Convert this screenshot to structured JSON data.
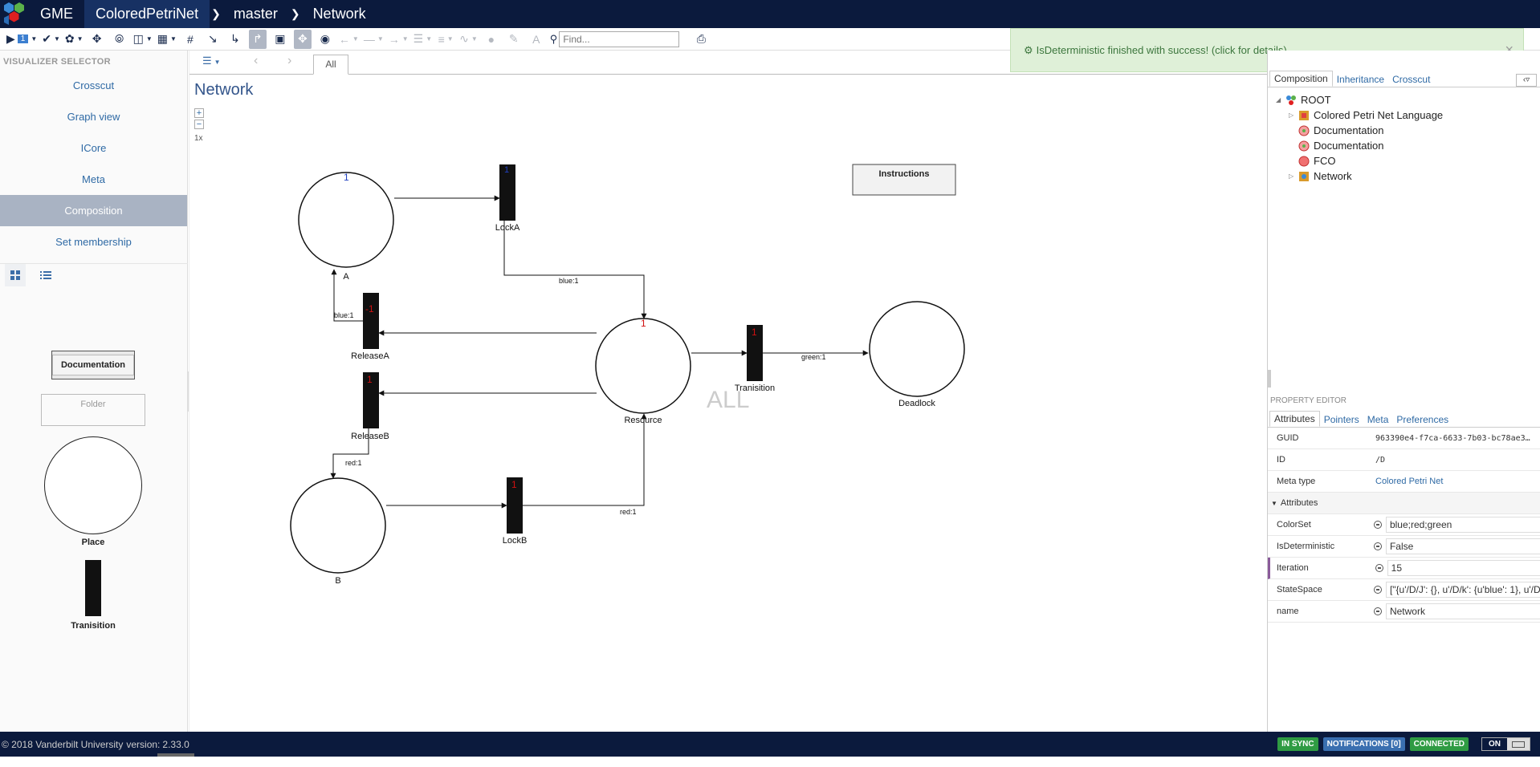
{
  "breadcrumb": {
    "app": "GME",
    "project": "ColoredPetriNet",
    "branch": "master",
    "node": "Network"
  },
  "toolbar": {
    "play_badge": "1",
    "find_placeholder": "Find..."
  },
  "visualizer_selector": {
    "title": "VISUALIZER SELECTOR",
    "items": [
      {
        "label": "Crosscut"
      },
      {
        "label": "Graph view"
      },
      {
        "label": "ICore"
      },
      {
        "label": "Meta"
      },
      {
        "label": "Composition",
        "selected": true
      },
      {
        "label": "Set membership"
      }
    ]
  },
  "part_browser": {
    "documentation": "Documentation",
    "folder": "Folder",
    "place": "Place",
    "transition": "Tranisition"
  },
  "editor": {
    "tab_all": "All",
    "title": "Network",
    "zoom_label": "1x",
    "instructions_box": "Instructions",
    "watermark": "ALL",
    "places": {
      "a": "A",
      "b": "B",
      "resource": "Resource",
      "deadlock": "Deadlock"
    },
    "transitions": {
      "locka": "LockA",
      "lockb": "LockB",
      "releasea": "ReleaseA",
      "releaseb": "ReleaseB",
      "tranisition": "Tranisition"
    },
    "arc_labels": {
      "blue1_locka": "blue:1",
      "blue1_releasea": "blue:1",
      "red1_releaseb": "red:1",
      "red1_lockb": "red:1",
      "green1": "green:1"
    },
    "tokens": {
      "a_blue": "1",
      "locka_blue": "1",
      "resource_red": "1",
      "releasea_marks": "-1",
      "releaseb_red": "1",
      "lockb_red": "1",
      "tranisition_red": "1"
    }
  },
  "notification": {
    "message": "IsDeterministic finished with success! (click for details)",
    "close": "×"
  },
  "object_browser": {
    "tabs": [
      "Composition",
      "Inheritance",
      "Crosscut"
    ],
    "tree": [
      {
        "label": "ROOT"
      },
      {
        "label": "Colored Petri Net Language"
      },
      {
        "label": "Documentation"
      },
      {
        "label": "Documentation"
      },
      {
        "label": "FCO"
      },
      {
        "label": "Network"
      }
    ]
  },
  "property_editor": {
    "title": "PROPERTY EDITOR",
    "tabs": [
      "Attributes",
      "Pointers",
      "Meta",
      "Preferences"
    ],
    "guid_label": "GUID",
    "guid_value": "963390e4-f7ca-6633-7b03-bc78ae3…",
    "id_label": "ID",
    "id_value": "/D",
    "metatype_label": "Meta type",
    "metatype_value": "Colored Petri Net",
    "attributes_section": "Attributes",
    "attributes": [
      {
        "name": "ColorSet",
        "value": "blue;red;green"
      },
      {
        "name": "IsDeterministic",
        "value": "False"
      },
      {
        "name": "Iteration",
        "value": "15"
      },
      {
        "name": "StateSpace",
        "value": "[\"{u'/D/J': {}, u'/D/k': {u'blue': 1}, u'/D/"
      },
      {
        "name": "name",
        "value": "Network"
      }
    ]
  },
  "footer": {
    "copyright": "© 2018 Vanderbilt University",
    "version_label": "version:",
    "version": "2.33.0",
    "in_sync": "IN SYNC",
    "notifications": "NOTIFICATIONS [0]",
    "connected": "CONNECTED",
    "on": "ON"
  },
  "colors": {
    "topbar": "#0b1a3d",
    "link": "#2f6aa5",
    "selected_item": "#a9b3c3",
    "notif_bg": "#dff0d8",
    "in_sync": "#2f9b43",
    "notifications_badge": "#3a6fb0"
  }
}
